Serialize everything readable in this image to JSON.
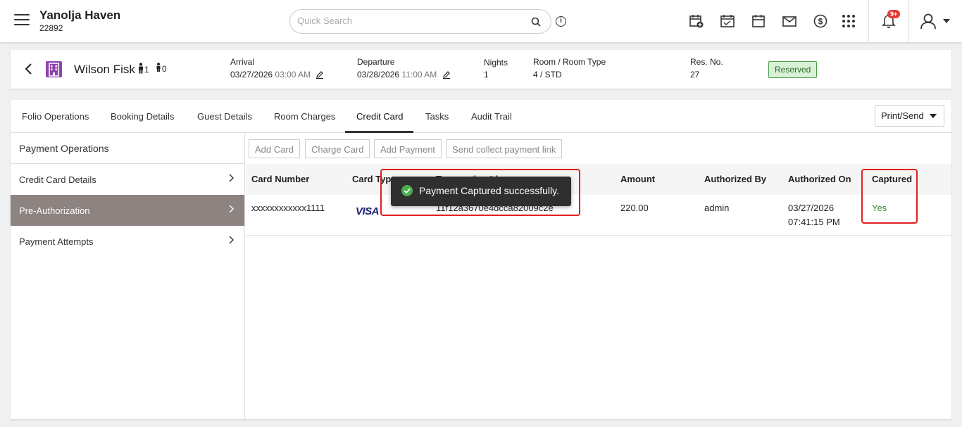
{
  "hotel": {
    "name": "Yanolja Haven",
    "code": "22892"
  },
  "search": {
    "placeholder": "Quick Search"
  },
  "notifications": {
    "badge": "9+"
  },
  "reservation": {
    "guest_name": "Wilson Fisk",
    "adults": "1",
    "children": "0",
    "arrival_label": "Arrival",
    "arrival_date": "03/27/2026",
    "arrival_time": "03:00 AM",
    "departure_label": "Departure",
    "departure_date": "03/28/2026",
    "departure_time": "11:00 AM",
    "nights_label": "Nights",
    "nights": "1",
    "room_label": "Room / Room Type",
    "room": "4 / STD",
    "resno_label": "Res. No.",
    "resno": "27",
    "status": "Reserved",
    "status_color": "#d9f1d6"
  },
  "tabs": [
    {
      "label": "Folio Operations"
    },
    {
      "label": "Booking Details"
    },
    {
      "label": "Guest Details"
    },
    {
      "label": "Room Charges"
    },
    {
      "label": "Credit Card"
    },
    {
      "label": "Tasks"
    },
    {
      "label": "Audit Trail"
    }
  ],
  "active_tab": "Credit Card",
  "print_send": "Print/Send",
  "left_panel": {
    "header": "Payment Operations",
    "items": [
      {
        "label": "Credit Card Details"
      },
      {
        "label": "Pre-Authorization"
      },
      {
        "label": "Payment Attempts"
      }
    ],
    "active": "Pre-Authorization"
  },
  "actions": {
    "add_card": "Add Card",
    "charge_card": "Charge Card",
    "add_payment": "Add Payment",
    "send_link": "Send collect payment link"
  },
  "table": {
    "headers": [
      "Card Number",
      "Card Type",
      "Transaction Id",
      "Amount",
      "Authorized By",
      "Authorized On",
      "Captured"
    ],
    "rows": [
      {
        "card_number": "xxxxxxxxxxxx1111",
        "card_type": "VISA",
        "transaction_id": "11f12a3670e4dcca82009c2e",
        "amount": "220.00",
        "authorized_by": "admin",
        "authorized_on_date": "03/27/2026",
        "authorized_on_time": "07:41:15 PM",
        "captured": "Yes"
      }
    ]
  },
  "toast": {
    "message": "Payment Captured successfully."
  },
  "colors": {
    "highlight": "#e02020",
    "active_item": "#8d8380",
    "yes": "#2e8b3d"
  }
}
